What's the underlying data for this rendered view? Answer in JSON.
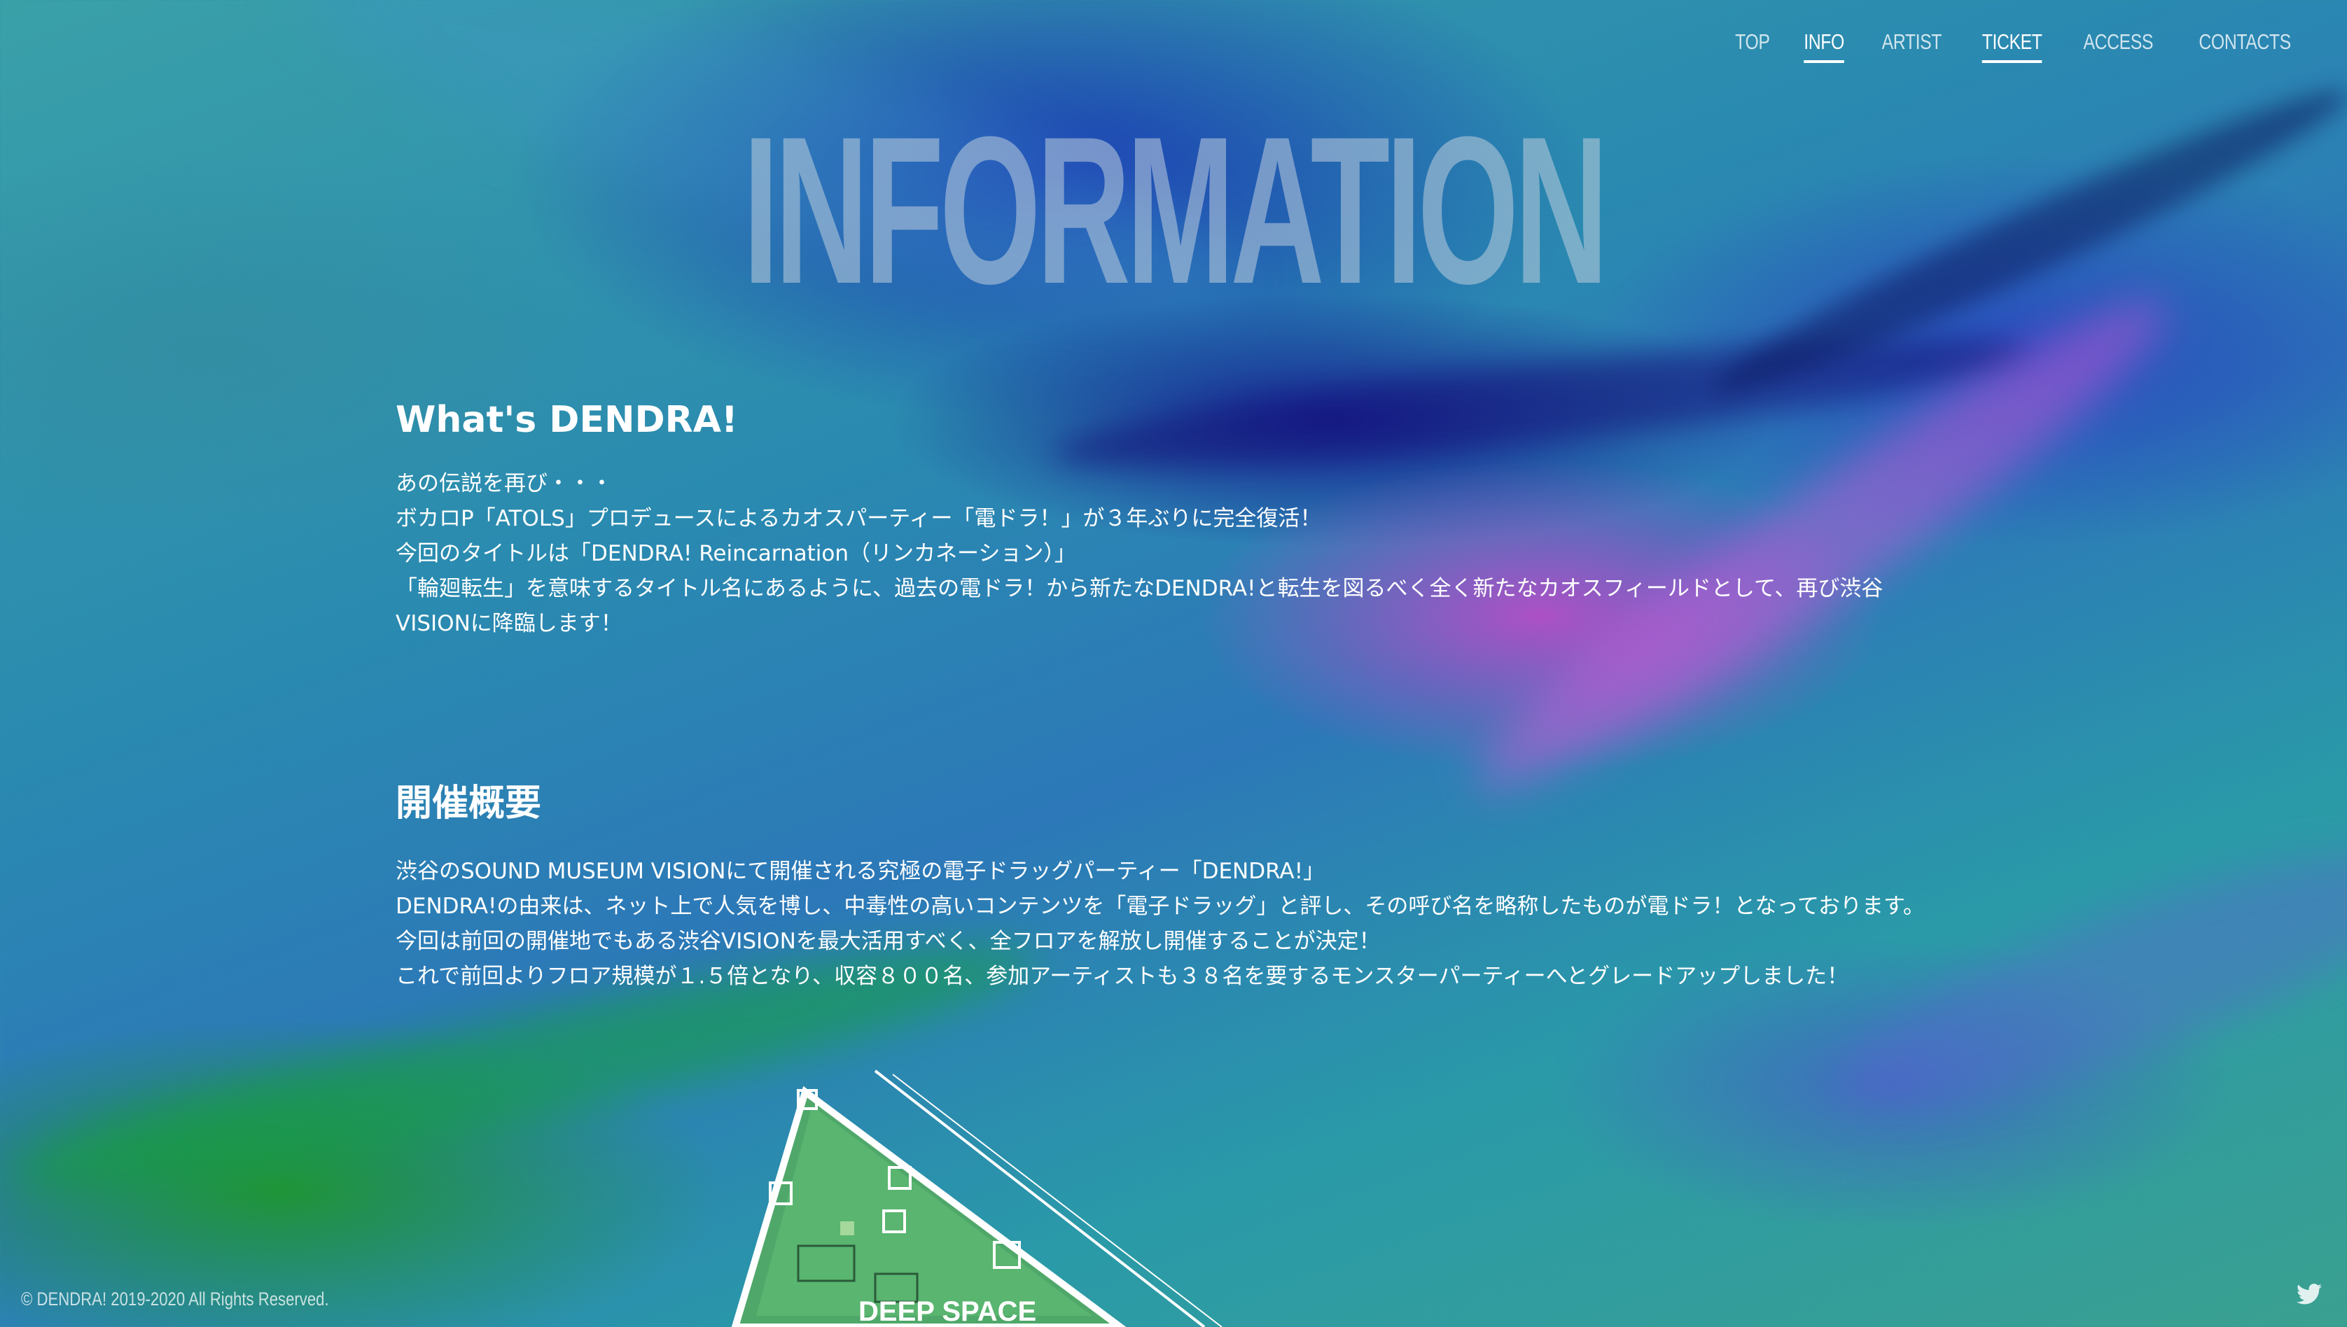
{
  "nav": {
    "items": [
      {
        "label": "TOP"
      },
      {
        "label": "INFO"
      },
      {
        "label": "ARTIST"
      },
      {
        "label": "TICKET"
      },
      {
        "label": "ACCESS"
      },
      {
        "label": "CONTACTS"
      }
    ]
  },
  "hero": {
    "title": "INFORMATION"
  },
  "about": {
    "heading": "What's DENDRA!",
    "lines": [
      "あの伝説を再び・・・",
      "ボカロP「ATOLS」プロデュースによるカオスパーティー「電ドラ！」が３年ぶりに完全復活！",
      "今回のタイトルは「DENDRA! Reincarnation（リンカネーション）」",
      "「輪廻転生」を意味するタイトル名にあるように、過去の電ドラ！から新たなDENDRA!と転生を図るべく全く新たなカオスフィールドとして、再び渋谷VISIONに降臨します！"
    ]
  },
  "overview": {
    "heading": "開催概要",
    "lines": [
      "渋谷のSOUND MUSEUM VISIONにて開催される究極の電子ドラッグパーティー「DENDRA!」",
      "DENDRA!の由来は、ネット上で人気を博し、中毒性の高いコンテンツを「電子ドラッグ」と評し、その呼び名を略称したものが電ドラ！となっております。",
      "今回は前回の開催地でもある渋谷VISIONを最大活用すべく、全フロアを解放し開催することが決定！",
      "これで前回よりフロア規模が１.５倍となり、収容８００名、参加アーティストも３８名を要するモンスターパーティーへとグレードアップしました！"
    ]
  },
  "floor_map": {
    "label": "DEEP SPACE"
  },
  "footer": {
    "copyright": "© DENDRA! 2019-2020 All Rights Reserved.",
    "social_icon": "twitter-icon"
  }
}
